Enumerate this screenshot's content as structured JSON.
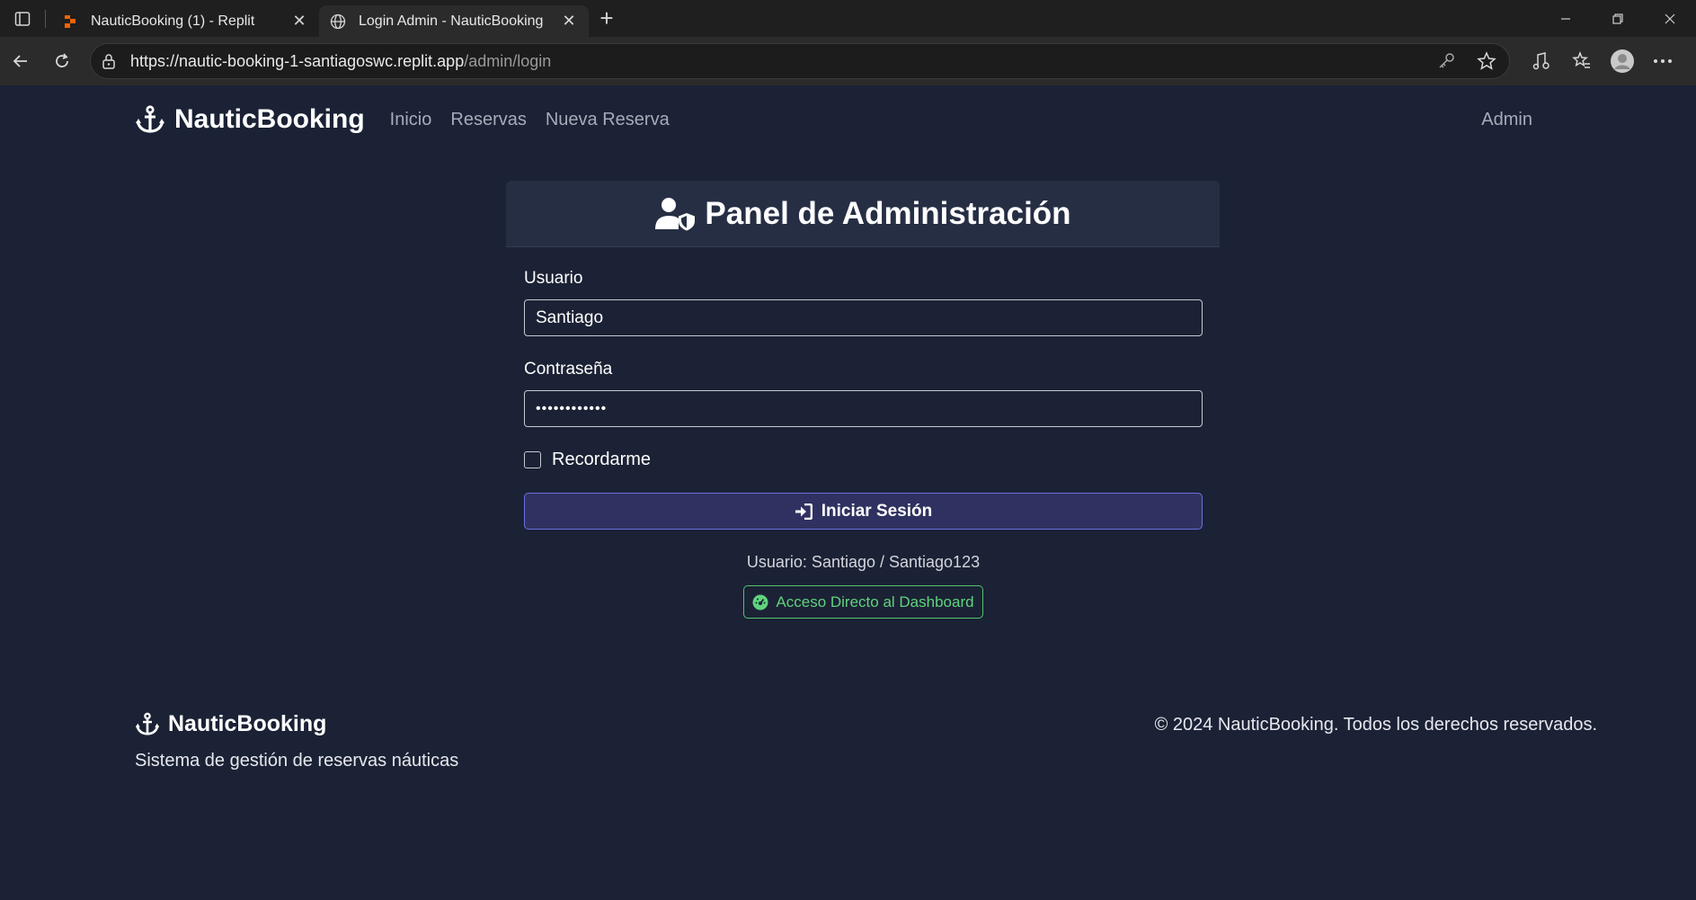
{
  "browser": {
    "tabs": [
      {
        "title": "NauticBooking (1) - Replit",
        "active": false
      },
      {
        "title": "Login Admin - NauticBooking",
        "active": true
      }
    ],
    "url_host": "https://nautic-booking-1-santiagoswc.replit.app",
    "url_path": "/admin/login"
  },
  "nav": {
    "brand": "NauticBooking",
    "links": [
      "Inicio",
      "Reservas",
      "Nueva Reserva"
    ],
    "admin": "Admin"
  },
  "login": {
    "title": "Panel de Administración",
    "username_label": "Usuario",
    "username_value": "Santiago",
    "password_label": "Contraseña",
    "password_value": "••••••••••••",
    "remember_label": "Recordarme",
    "submit_label": "Iniciar Sesión",
    "hint": "Usuario: Santiago / Santiago123",
    "dashboard_label": "Acceso Directo al Dashboard"
  },
  "footer": {
    "brand": "NauticBooking",
    "tagline": "Sistema de gestión de reservas náuticas",
    "copyright": "© 2024 NauticBooking. Todos los derechos reservados."
  },
  "colors": {
    "background": "#1b2235",
    "card_header": "#262e44",
    "primary_button": "#2f3260",
    "success": "#4ec66b"
  }
}
